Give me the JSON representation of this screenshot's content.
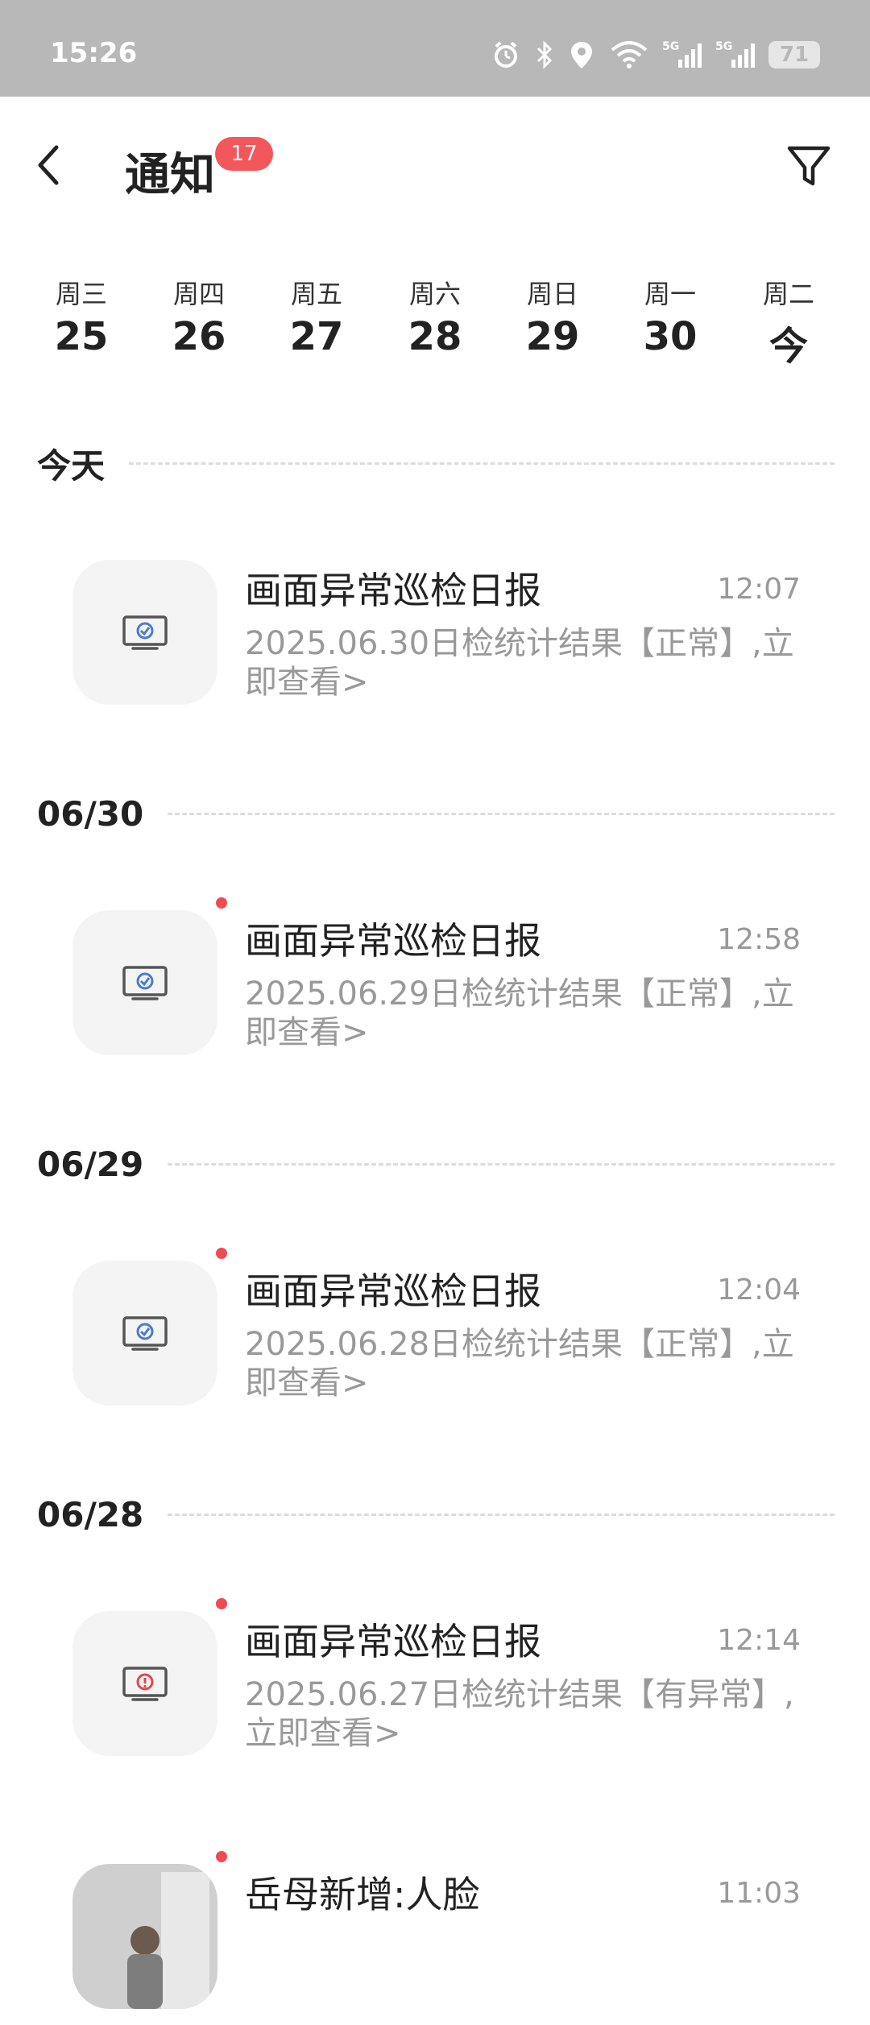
{
  "status_bar": {
    "time": "15:26",
    "battery": "71",
    "icons": [
      "alarm-icon",
      "bluetooth-icon",
      "location-icon",
      "wifi-icon",
      "signal-5g-icon",
      "signal-5g-icon",
      "battery-icon"
    ]
  },
  "header": {
    "title": "通知",
    "badge": "17"
  },
  "week": [
    {
      "name": "周三",
      "num": "25"
    },
    {
      "name": "周四",
      "num": "26"
    },
    {
      "name": "周五",
      "num": "27"
    },
    {
      "name": "周六",
      "num": "28"
    },
    {
      "name": "周日",
      "num": "29"
    },
    {
      "name": "周一",
      "num": "30"
    },
    {
      "name": "周二",
      "num": "今"
    }
  ],
  "sections": [
    {
      "label": "今天",
      "item": {
        "title": "画面异常巡检日报",
        "time": "12:07",
        "desc": "2025.06.30日检统计结果【正常】,立即查看>",
        "icon": "inspection-normal-icon",
        "unread": false
      }
    },
    {
      "label": "06/30",
      "item": {
        "title": "画面异常巡检日报",
        "time": "12:58",
        "desc": "2025.06.29日检统计结果【正常】,立即查看>",
        "icon": "inspection-normal-icon",
        "unread": true
      }
    },
    {
      "label": "06/29",
      "item": {
        "title": "画面异常巡检日报",
        "time": "12:04",
        "desc": "2025.06.28日检统计结果【正常】,立即查看>",
        "icon": "inspection-normal-icon",
        "unread": true
      }
    },
    {
      "label": "06/28",
      "item": {
        "title": "画面异常巡检日报",
        "time": "12:14",
        "desc": "2025.06.27日检统计结果【有异常】,立即查看>",
        "icon": "inspection-abnormal-icon",
        "unread": true
      }
    }
  ],
  "last_item": {
    "title": "岳母新增:人脸",
    "time": "11:03",
    "unread": true
  },
  "colors": {
    "accent": "#f2575c",
    "unread_dot": "#ef4b52",
    "muted_text": "#999999",
    "status_bar": "#b8b8b8"
  }
}
